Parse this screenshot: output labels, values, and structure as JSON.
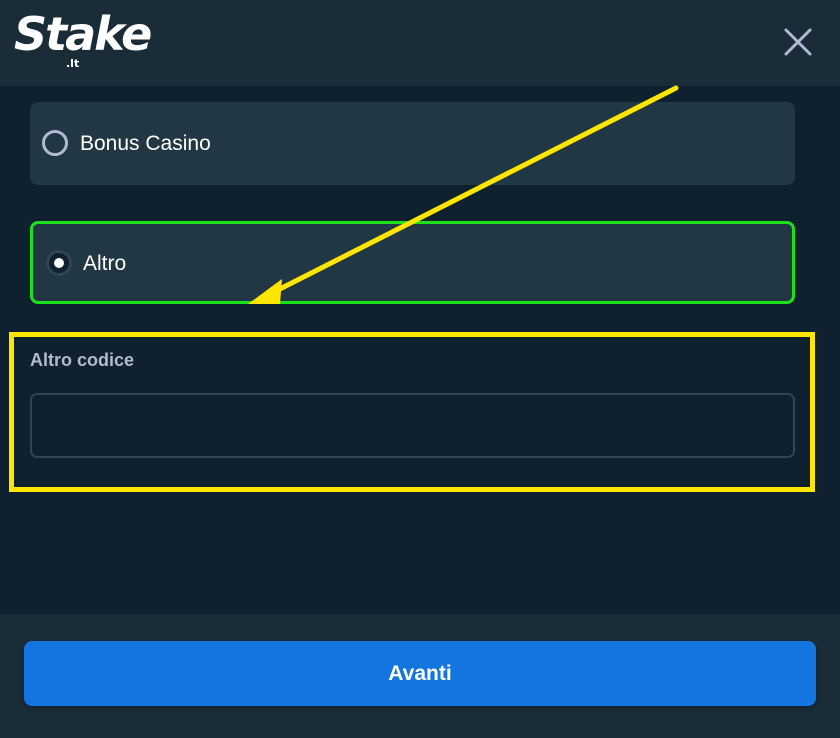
{
  "header": {
    "logo_text": "Stake",
    "logo_tld": ".lt",
    "close_icon": "close-icon"
  },
  "options": [
    {
      "label": "Bonus Casino",
      "selected": false
    },
    {
      "label": "Altro",
      "selected": true
    }
  ],
  "other_code": {
    "label": "Altro codice",
    "value": "",
    "placeholder": ""
  },
  "footer": {
    "next_label": "Avanti"
  },
  "colors": {
    "background": "#0f212e",
    "header": "#1a2c38",
    "card": "#213743",
    "selected_border": "#1be01b",
    "annotation": "#ffe600",
    "primary": "#1475e1",
    "muted_text": "#b1bad3"
  },
  "annotations": {
    "arrow_icon": "arrow-icon",
    "highlight_box": "highlight-box"
  }
}
